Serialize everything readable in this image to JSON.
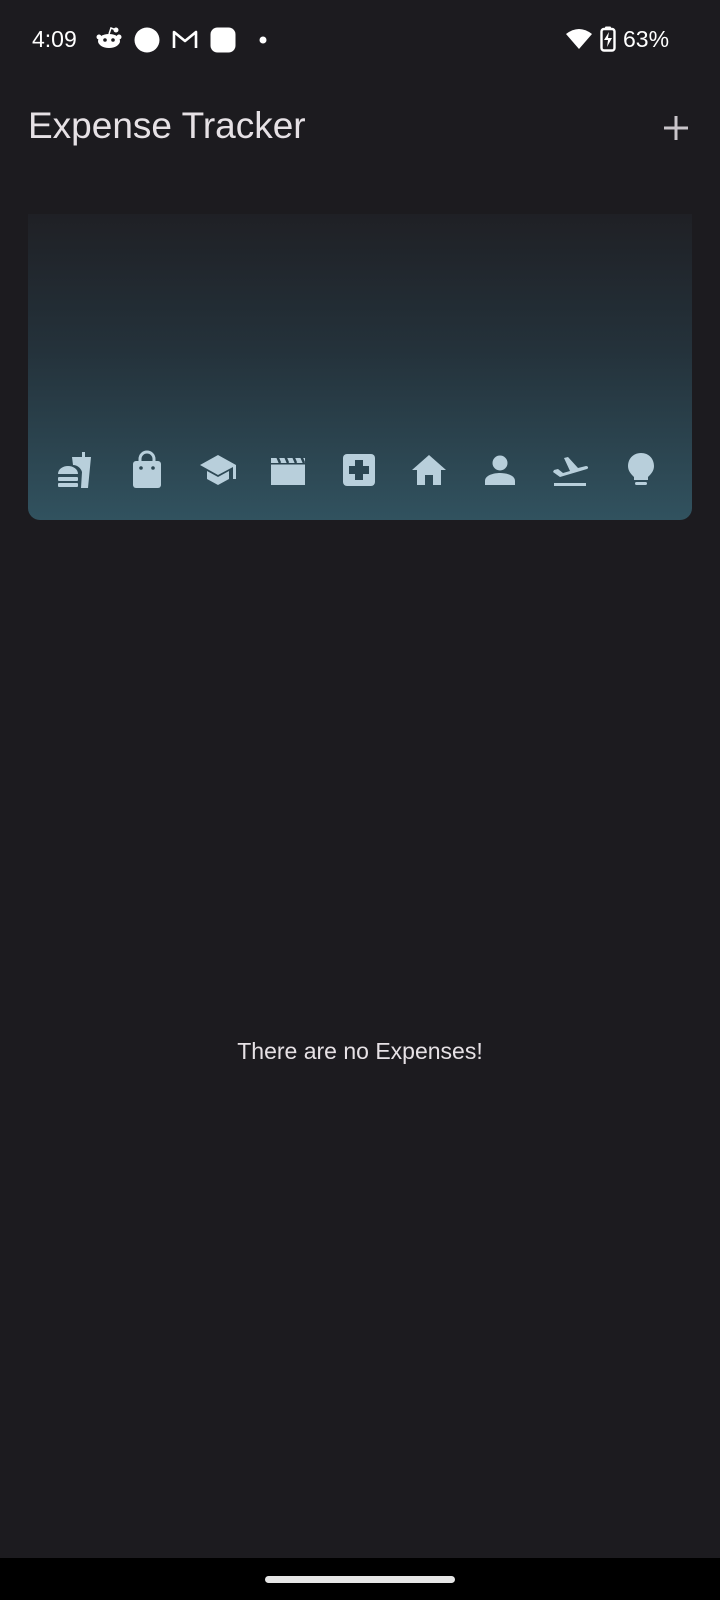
{
  "status_bar": {
    "time": "4:09",
    "battery_percent": "63%",
    "notification_icons": [
      "reddit-icon",
      "circle-app-icon",
      "gmail-icon",
      "rounded-square-app-icon",
      "dot-icon"
    ],
    "system_icons": [
      "wifi-icon",
      "battery-charging-icon"
    ]
  },
  "app_bar": {
    "title": "Expense Tracker",
    "add_icon": "plus-icon"
  },
  "chart": {
    "category_icons": [
      "fastfood-icon",
      "shopping-bag-icon",
      "school-icon",
      "movie-icon",
      "medical-icon",
      "home-icon",
      "person-icon",
      "flight-icon",
      "lightbulb-icon"
    ],
    "bar_color": "#31525f",
    "icon_color": "#b8cfdb"
  },
  "empty_state": {
    "message": "There are no Expenses!"
  },
  "colors": {
    "background": "#1c1b1f",
    "text": "#e6e1e5"
  }
}
